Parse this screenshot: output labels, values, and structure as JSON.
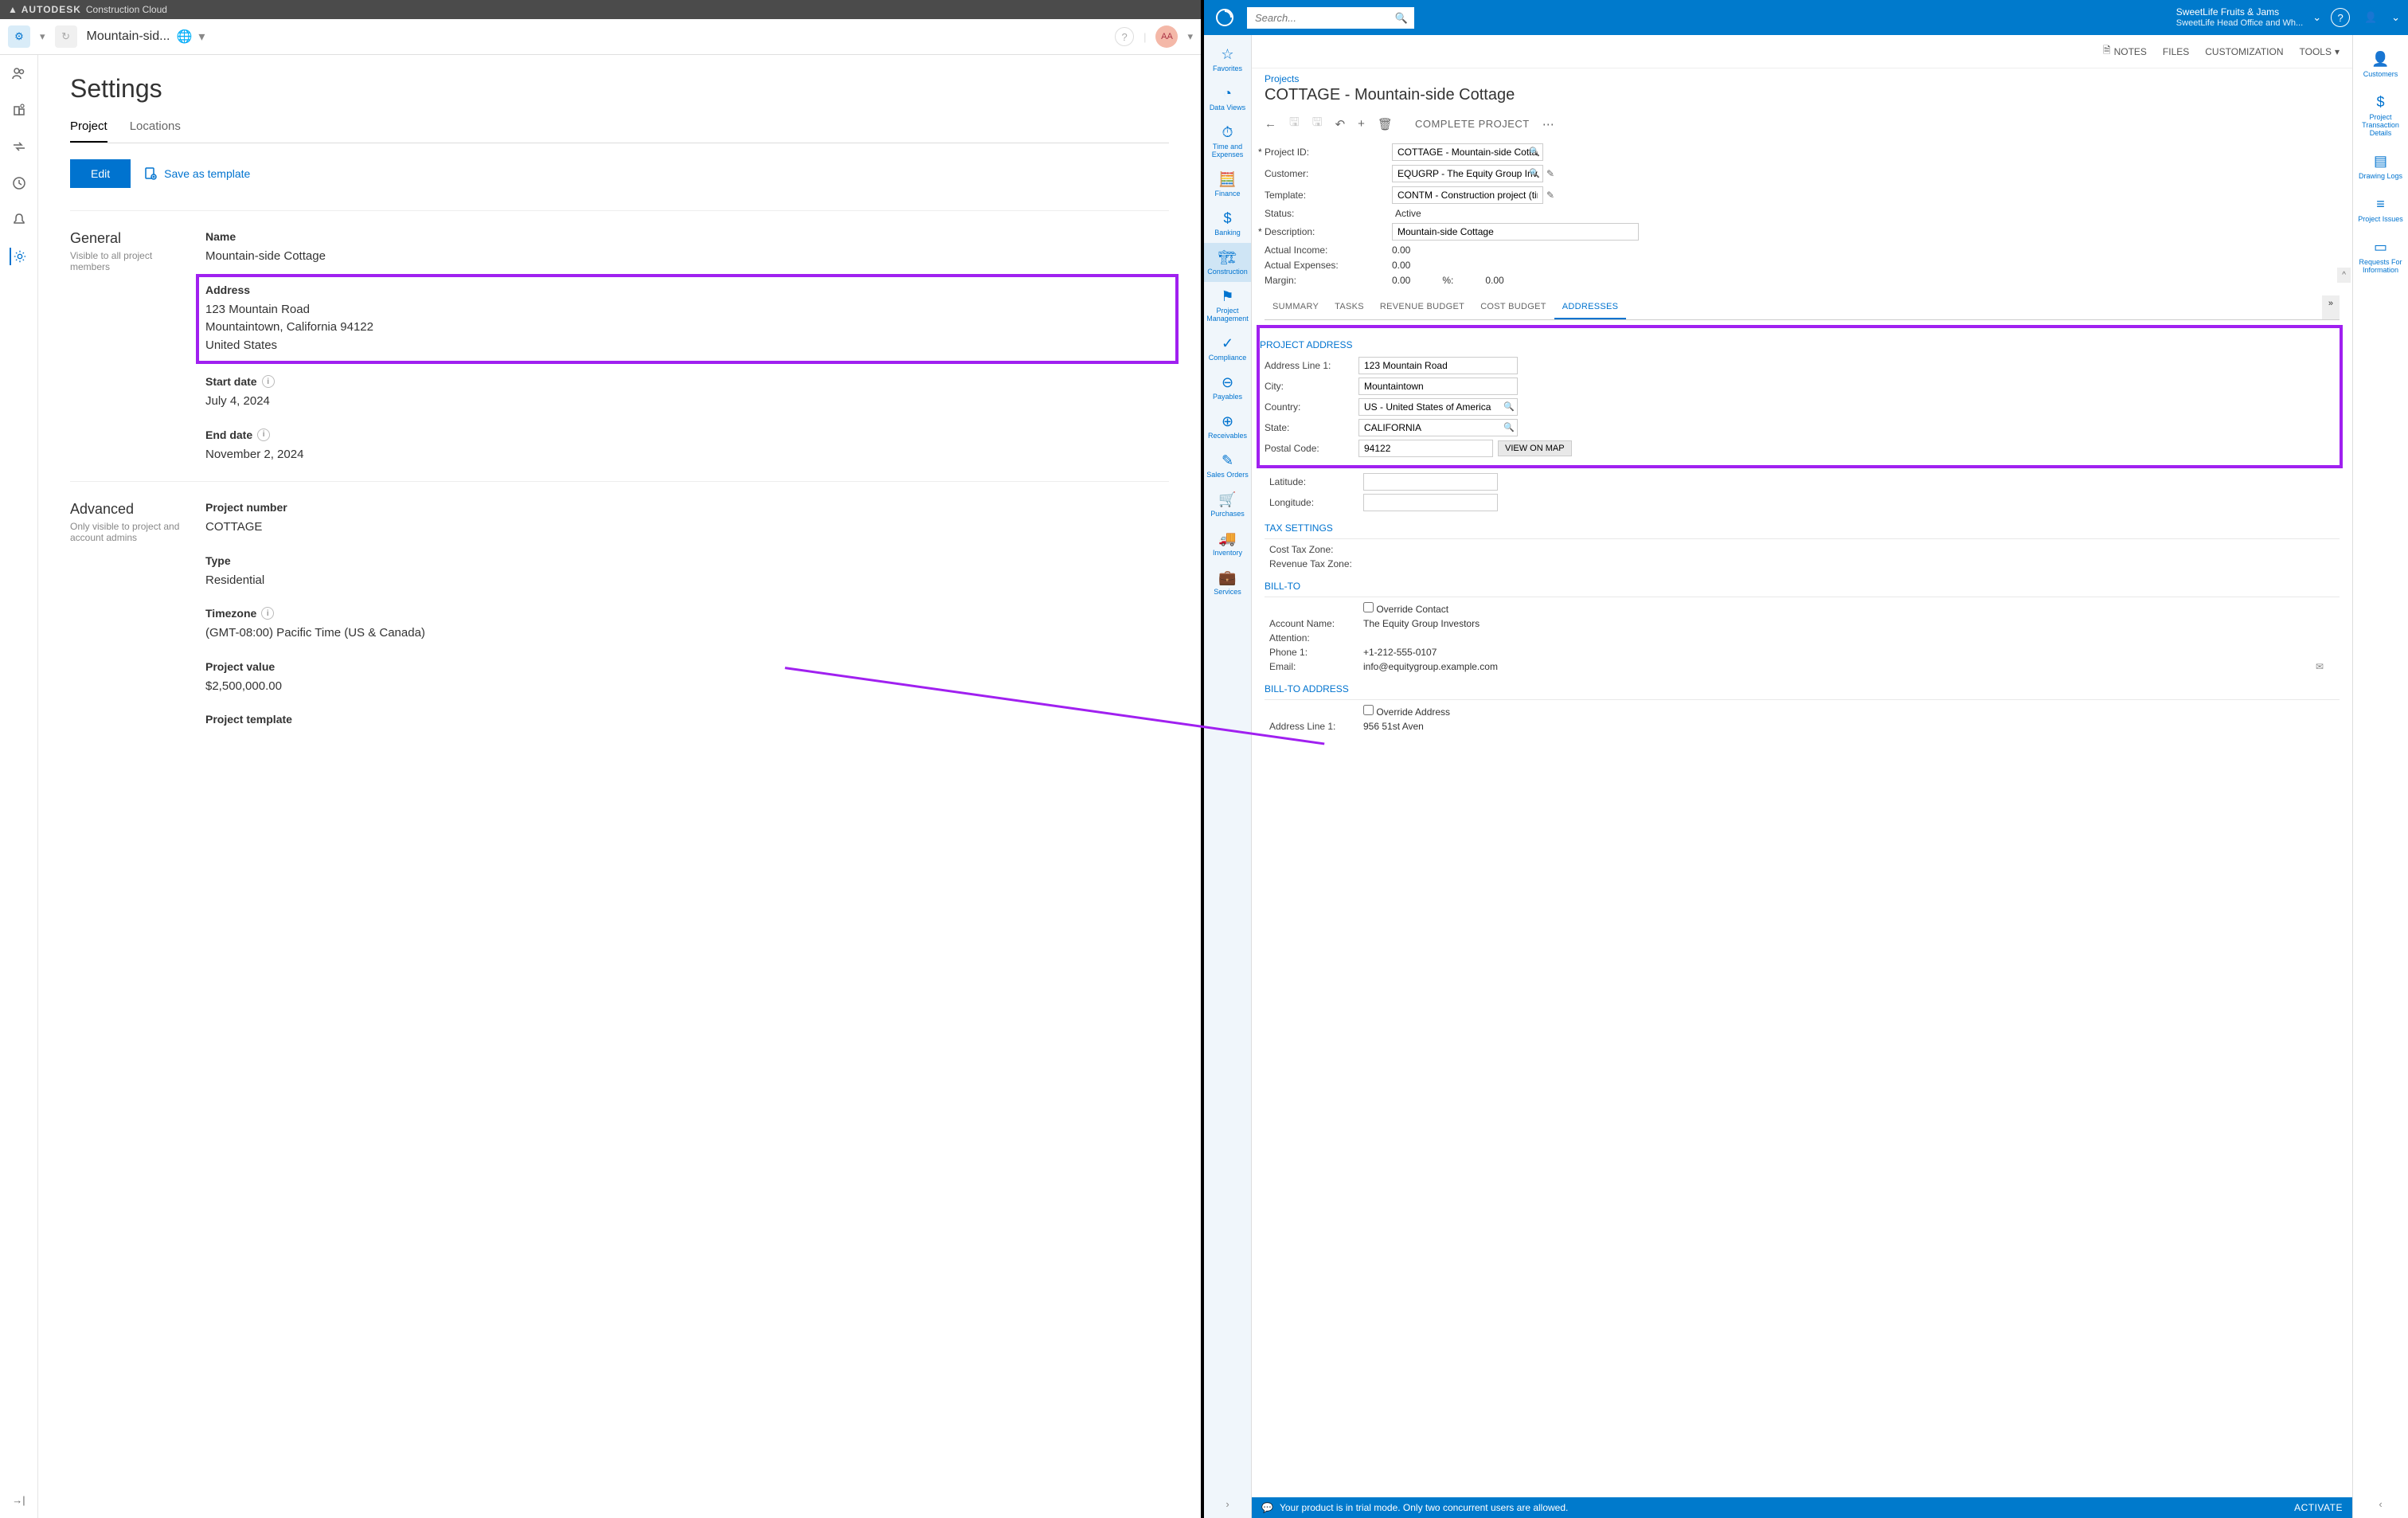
{
  "left": {
    "topbar": {
      "brand": "AUTODESK",
      "product": "Construction Cloud"
    },
    "header": {
      "project_name": "Mountain-sid...",
      "avatar": "AA"
    },
    "sidebar_icons": [
      "users",
      "company",
      "swap",
      "history",
      "bell",
      "gear"
    ],
    "page_title": "Settings",
    "tabs": {
      "project": "Project",
      "locations": "Locations"
    },
    "edit_btn": "Edit",
    "save_template": "Save as template",
    "sections": {
      "general": {
        "title": "General",
        "subtitle": "Visible to all project members"
      },
      "advanced": {
        "title": "Advanced",
        "subtitle": "Only visible to project and account admins"
      }
    },
    "fields": {
      "name": {
        "label": "Name",
        "value": "Mountain-side Cottage"
      },
      "address": {
        "label": "Address",
        "line1": "123 Mountain Road",
        "line2": "Mountaintown, California 94122",
        "line3": "United States"
      },
      "start_date": {
        "label": "Start date",
        "value": "July 4, 2024"
      },
      "end_date": {
        "label": "End date",
        "value": "November 2, 2024"
      },
      "project_number": {
        "label": "Project number",
        "value": "COTTAGE"
      },
      "type": {
        "label": "Type",
        "value": "Residential"
      },
      "timezone": {
        "label": "Timezone",
        "value": "(GMT-08:00) Pacific Time (US & Canada)"
      },
      "project_value": {
        "label": "Project value",
        "value": "$2,500,000.00"
      },
      "project_template": {
        "label": "Project template"
      }
    }
  },
  "right": {
    "search_placeholder": "Search...",
    "company": {
      "name": "SweetLife Fruits & Jams",
      "branch": "SweetLife Head Office and Wh..."
    },
    "leftnav": [
      {
        "label": "Favorites",
        "icon": "☆"
      },
      {
        "label": "Data Views",
        "icon": "◔"
      },
      {
        "label": "Time and Expenses",
        "icon": "⏱"
      },
      {
        "label": "Finance",
        "icon": "🧮"
      },
      {
        "label": "Banking",
        "icon": "$"
      },
      {
        "label": "Construction",
        "icon": "🏗",
        "active": true
      },
      {
        "label": "Project Management",
        "icon": "⚑"
      },
      {
        "label": "Compliance",
        "icon": "✓"
      },
      {
        "label": "Payables",
        "icon": "⊖"
      },
      {
        "label": "Receivables",
        "icon": "⊕"
      },
      {
        "label": "Sales Orders",
        "icon": "✎"
      },
      {
        "label": "Purchases",
        "icon": "🛒"
      },
      {
        "label": "Inventory",
        "icon": "🚚"
      },
      {
        "label": "Services",
        "icon": "💼"
      }
    ],
    "rightnav": [
      {
        "label": "Customers",
        "icon": "👤"
      },
      {
        "label": "Project Transaction Details",
        "icon": "$"
      },
      {
        "label": "Drawing Logs",
        "icon": "▤"
      },
      {
        "label": "Project Issues",
        "icon": "≡"
      },
      {
        "label": "Requests For Information",
        "icon": "▭"
      }
    ],
    "toolbar": {
      "notes": "NOTES",
      "files": "FILES",
      "customization": "CUSTOMIZATION",
      "tools": "TOOLS"
    },
    "breadcrumb": "Projects",
    "page_title": "COTTAGE - Mountain-side Cottage",
    "complete_btn": "COMPLETE PROJECT",
    "summary": {
      "project_id": {
        "label": "Project ID:",
        "value": "COTTAGE - Mountain-side Cottage"
      },
      "customer": {
        "label": "Customer:",
        "value": "EQUGRP - The Equity Group Investors"
      },
      "template": {
        "label": "Template:",
        "value": "CONTM - Construction project (time and m"
      },
      "status": {
        "label": "Status:",
        "value": "Active"
      },
      "description": {
        "label": "Description:",
        "value": "Mountain-side Cottage"
      },
      "actual_income": {
        "label": "Actual Income:",
        "value": "0.00"
      },
      "actual_expenses": {
        "label": "Actual Expenses:",
        "value": "0.00"
      },
      "margin": {
        "label": "Margin:",
        "value": "0.00",
        "pct_label": "%:",
        "pct_value": "0.00"
      }
    },
    "tabs2": [
      "SUMMARY",
      "TASKS",
      "REVENUE BUDGET",
      "COST BUDGET",
      "ADDRESSES"
    ],
    "project_address": {
      "title": "PROJECT ADDRESS",
      "line1": {
        "label": "Address Line 1:",
        "value": "123 Mountain Road"
      },
      "city": {
        "label": "City:",
        "value": "Mountaintown"
      },
      "country": {
        "label": "Country:",
        "value": "US - United States of America"
      },
      "state": {
        "label": "State:",
        "value": "CALIFORNIA"
      },
      "postal": {
        "label": "Postal Code:",
        "value": "94122"
      },
      "view_map": "VIEW ON MAP",
      "latitude": {
        "label": "Latitude:"
      },
      "longitude": {
        "label": "Longitude:"
      }
    },
    "tax_settings": {
      "title": "TAX SETTINGS",
      "cost_tax": "Cost Tax Zone:",
      "revenue_tax": "Revenue Tax Zone:"
    },
    "bill_to": {
      "title": "BILL-TO",
      "override_contact": "Override Contact",
      "account_name": {
        "label": "Account Name:",
        "value": "The Equity Group Investors"
      },
      "attention": "Attention:",
      "phone1": {
        "label": "Phone 1:",
        "value": "+1-212-555-0107"
      },
      "email": {
        "label": "Email:",
        "value": "info@equitygroup.example.com"
      }
    },
    "bill_to_address": {
      "title": "BILL-TO ADDRESS",
      "override_address": "Override Address",
      "line1": {
        "label": "Address Line 1:",
        "value": "956 51st Aven"
      }
    },
    "footer": {
      "trial_msg": "Your product is in trial mode. Only two concurrent users are allowed.",
      "activate": "ACTIVATE"
    }
  }
}
